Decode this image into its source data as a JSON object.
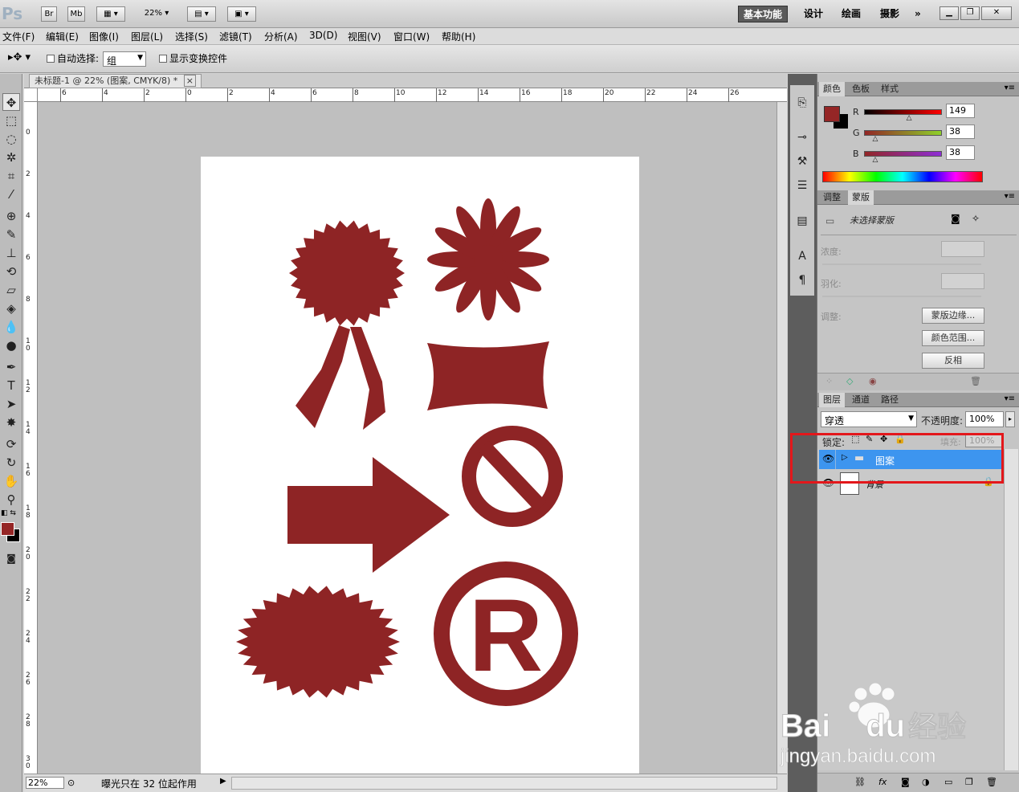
{
  "app": {
    "logo": "Ps",
    "bridge": "Br",
    "minibridge": "Mb",
    "zoom_top": "22%"
  },
  "workspaces": [
    "基本功能",
    "设计",
    "绘画",
    "摄影"
  ],
  "workspace_more": "»",
  "menu": [
    "文件(F)",
    "编辑(E)",
    "图像(I)",
    "图层(L)",
    "选择(S)",
    "滤镜(T)",
    "分析(A)",
    "3D(D)",
    "视图(V)",
    "窗口(W)",
    "帮助(H)"
  ],
  "options": {
    "auto_select_label": "自动选择:",
    "auto_select_value": "组",
    "show_transform_label": "显示变换控件"
  },
  "document": {
    "tab_title": "未标题-1 @ 22% (图案, CMYK/8) *",
    "close": "×"
  },
  "ruler_h": [
    "6",
    "4",
    "2",
    "0",
    "2",
    "4",
    "6",
    "8",
    "10",
    "12",
    "14",
    "16",
    "18",
    "20",
    "22",
    "24",
    "26"
  ],
  "ruler_v": [
    "0",
    "2",
    "4",
    "6",
    "8",
    "1 0",
    "1 2",
    "1 4",
    "1 6",
    "1 8",
    "2 0",
    "2 2",
    "2 4",
    "2 6",
    "2 8",
    "3 0"
  ],
  "shapes": {
    "fill": "#8e2425"
  },
  "status": {
    "zoom": "22%",
    "message": "曝光只在 32 位起作用"
  },
  "color_panel": {
    "tabs": [
      "颜色",
      "色板",
      "样式"
    ],
    "foreground": "#952626",
    "r_label": "R",
    "g_label": "G",
    "b_label": "B",
    "r": "149",
    "g": "38",
    "b": "38",
    "r_level": 0.584,
    "g_level": 0.149,
    "b_level": 0.149
  },
  "masks_panel": {
    "tabs": [
      "调整",
      "蒙版"
    ],
    "title": "未选择蒙版",
    "density_label": "浓度:",
    "feather_label": "羽化:",
    "adjust_label": "调整:",
    "btn_edge": "蒙版边缘...",
    "btn_color_range": "颜色范围...",
    "btn_invert": "反相"
  },
  "layers_panel": {
    "tabs": [
      "图层",
      "通道",
      "路径"
    ],
    "blend_mode": "穿透",
    "opacity_label": "不透明度:",
    "opacity_value": "100%",
    "lock_label": "锁定:",
    "fill_label": "填充:",
    "fill_value": "100%",
    "layers": [
      {
        "name": "图案",
        "type": "group",
        "selected": true
      },
      {
        "name": "背景",
        "type": "background",
        "selected": false
      }
    ]
  },
  "watermark": {
    "brand": "Bai",
    "brand2": "du",
    "product": "经验",
    "url": "jingyan.baidu.com"
  }
}
